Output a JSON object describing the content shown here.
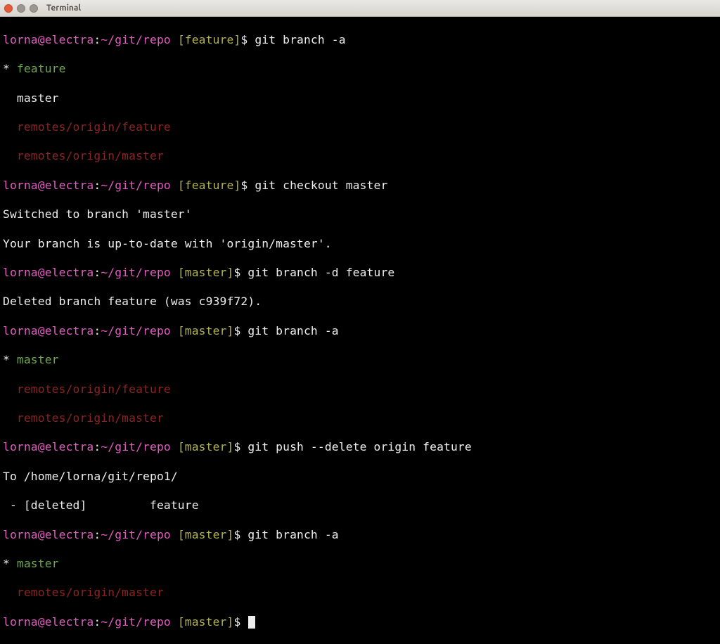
{
  "window": {
    "title": "Terminal"
  },
  "prompt": {
    "userhost": "lorna@electra",
    "path": "~/git/repo",
    "branch_feature": "[feature]",
    "branch_master": "[master]",
    "sigil": "$"
  },
  "cmds": {
    "ga1": "git branch -a",
    "checkout": "git checkout master",
    "del_local": "git branch -d feature",
    "ga2": "git branch -a",
    "push_del": "git push --delete origin feature",
    "ga3": "git branch -a"
  },
  "out": {
    "star": "*",
    "feature": "feature",
    "master": "master",
    "indent_master": "  master",
    "remote_feature": "  remotes/origin/feature",
    "remote_master": "  remotes/origin/master",
    "switched": "Switched to branch 'master'",
    "uptodate": "Your branch is up-to-date with 'origin/master'.",
    "deleted_local": "Deleted branch feature (was c939f72).",
    "push_to": "To /home/lorna/git/repo1/",
    "push_deleted": " - [deleted]         feature"
  }
}
